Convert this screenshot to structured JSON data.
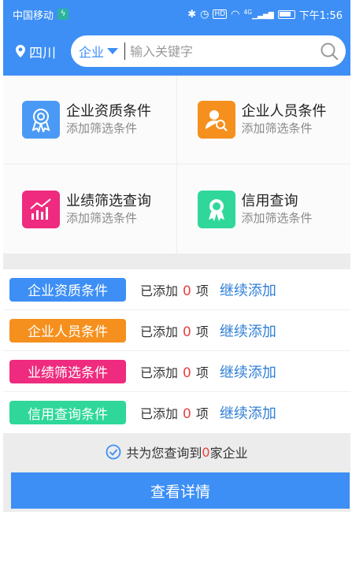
{
  "status_bar": {
    "carrier": "中国移动",
    "network": "4G",
    "time": "下午1:56"
  },
  "header": {
    "location": "四川",
    "category": "企业",
    "search_placeholder": "输入关键字",
    "colors": {
      "primary": "#3d8ff5"
    }
  },
  "filters": [
    {
      "title": "企业资质条件",
      "subtitle": "添加筛选条件",
      "icon": "award-icon"
    },
    {
      "title": "企业人员条件",
      "subtitle": "添加筛选条件",
      "icon": "person-search-icon"
    },
    {
      "title": "业绩筛选查询",
      "subtitle": "添加筛选条件",
      "icon": "bar-chart-icon"
    },
    {
      "title": "信用查询",
      "subtitle": "添加筛选条件",
      "icon": "credit-badge-icon"
    }
  ],
  "conditions": [
    {
      "tag": "企业资质条件",
      "added_prefix": "已添加",
      "count": "0",
      "unit": "项",
      "action": "继续添加",
      "color": "#3d8ff5"
    },
    {
      "tag": "企业人员条件",
      "added_prefix": "已添加",
      "count": "0",
      "unit": "项",
      "action": "继续添加",
      "color": "#f5901e"
    },
    {
      "tag": "业绩筛选条件",
      "added_prefix": "已添加",
      "count": "0",
      "unit": "项",
      "action": "继续添加",
      "color": "#ee2b7e"
    },
    {
      "tag": "信用查询条件",
      "added_prefix": "已添加",
      "count": "0",
      "unit": "项",
      "action": "继续添加",
      "color": "#2fd89a"
    }
  ],
  "summary": {
    "prefix": "共为您查询到",
    "count": "0",
    "suffix": "家企业"
  },
  "details_button": "查看详情"
}
